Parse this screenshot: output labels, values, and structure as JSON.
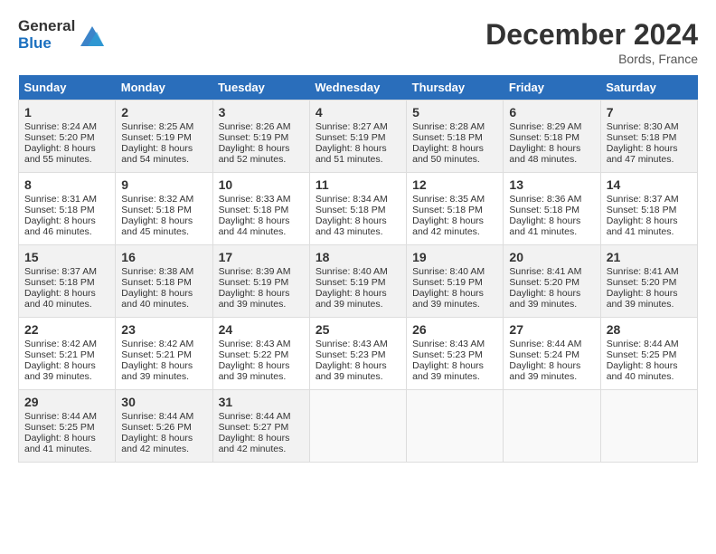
{
  "header": {
    "logo_line1": "General",
    "logo_line2": "Blue",
    "month_year": "December 2024",
    "location": "Bords, France"
  },
  "days_of_week": [
    "Sunday",
    "Monday",
    "Tuesday",
    "Wednesday",
    "Thursday",
    "Friday",
    "Saturday"
  ],
  "weeks": [
    [
      {
        "day": 1,
        "sunrise": "Sunrise: 8:24 AM",
        "sunset": "Sunset: 5:20 PM",
        "daylight": "Daylight: 8 hours and 55 minutes."
      },
      {
        "day": 2,
        "sunrise": "Sunrise: 8:25 AM",
        "sunset": "Sunset: 5:19 PM",
        "daylight": "Daylight: 8 hours and 54 minutes."
      },
      {
        "day": 3,
        "sunrise": "Sunrise: 8:26 AM",
        "sunset": "Sunset: 5:19 PM",
        "daylight": "Daylight: 8 hours and 52 minutes."
      },
      {
        "day": 4,
        "sunrise": "Sunrise: 8:27 AM",
        "sunset": "Sunset: 5:19 PM",
        "daylight": "Daylight: 8 hours and 51 minutes."
      },
      {
        "day": 5,
        "sunrise": "Sunrise: 8:28 AM",
        "sunset": "Sunset: 5:18 PM",
        "daylight": "Daylight: 8 hours and 50 minutes."
      },
      {
        "day": 6,
        "sunrise": "Sunrise: 8:29 AM",
        "sunset": "Sunset: 5:18 PM",
        "daylight": "Daylight: 8 hours and 48 minutes."
      },
      {
        "day": 7,
        "sunrise": "Sunrise: 8:30 AM",
        "sunset": "Sunset: 5:18 PM",
        "daylight": "Daylight: 8 hours and 47 minutes."
      }
    ],
    [
      {
        "day": 8,
        "sunrise": "Sunrise: 8:31 AM",
        "sunset": "Sunset: 5:18 PM",
        "daylight": "Daylight: 8 hours and 46 minutes."
      },
      {
        "day": 9,
        "sunrise": "Sunrise: 8:32 AM",
        "sunset": "Sunset: 5:18 PM",
        "daylight": "Daylight: 8 hours and 45 minutes."
      },
      {
        "day": 10,
        "sunrise": "Sunrise: 8:33 AM",
        "sunset": "Sunset: 5:18 PM",
        "daylight": "Daylight: 8 hours and 44 minutes."
      },
      {
        "day": 11,
        "sunrise": "Sunrise: 8:34 AM",
        "sunset": "Sunset: 5:18 PM",
        "daylight": "Daylight: 8 hours and 43 minutes."
      },
      {
        "day": 12,
        "sunrise": "Sunrise: 8:35 AM",
        "sunset": "Sunset: 5:18 PM",
        "daylight": "Daylight: 8 hours and 42 minutes."
      },
      {
        "day": 13,
        "sunrise": "Sunrise: 8:36 AM",
        "sunset": "Sunset: 5:18 PM",
        "daylight": "Daylight: 8 hours and 41 minutes."
      },
      {
        "day": 14,
        "sunrise": "Sunrise: 8:37 AM",
        "sunset": "Sunset: 5:18 PM",
        "daylight": "Daylight: 8 hours and 41 minutes."
      }
    ],
    [
      {
        "day": 15,
        "sunrise": "Sunrise: 8:37 AM",
        "sunset": "Sunset: 5:18 PM",
        "daylight": "Daylight: 8 hours and 40 minutes."
      },
      {
        "day": 16,
        "sunrise": "Sunrise: 8:38 AM",
        "sunset": "Sunset: 5:18 PM",
        "daylight": "Daylight: 8 hours and 40 minutes."
      },
      {
        "day": 17,
        "sunrise": "Sunrise: 8:39 AM",
        "sunset": "Sunset: 5:19 PM",
        "daylight": "Daylight: 8 hours and 39 minutes."
      },
      {
        "day": 18,
        "sunrise": "Sunrise: 8:40 AM",
        "sunset": "Sunset: 5:19 PM",
        "daylight": "Daylight: 8 hours and 39 minutes."
      },
      {
        "day": 19,
        "sunrise": "Sunrise: 8:40 AM",
        "sunset": "Sunset: 5:19 PM",
        "daylight": "Daylight: 8 hours and 39 minutes."
      },
      {
        "day": 20,
        "sunrise": "Sunrise: 8:41 AM",
        "sunset": "Sunset: 5:20 PM",
        "daylight": "Daylight: 8 hours and 39 minutes."
      },
      {
        "day": 21,
        "sunrise": "Sunrise: 8:41 AM",
        "sunset": "Sunset: 5:20 PM",
        "daylight": "Daylight: 8 hours and 39 minutes."
      }
    ],
    [
      {
        "day": 22,
        "sunrise": "Sunrise: 8:42 AM",
        "sunset": "Sunset: 5:21 PM",
        "daylight": "Daylight: 8 hours and 39 minutes."
      },
      {
        "day": 23,
        "sunrise": "Sunrise: 8:42 AM",
        "sunset": "Sunset: 5:21 PM",
        "daylight": "Daylight: 8 hours and 39 minutes."
      },
      {
        "day": 24,
        "sunrise": "Sunrise: 8:43 AM",
        "sunset": "Sunset: 5:22 PM",
        "daylight": "Daylight: 8 hours and 39 minutes."
      },
      {
        "day": 25,
        "sunrise": "Sunrise: 8:43 AM",
        "sunset": "Sunset: 5:23 PM",
        "daylight": "Daylight: 8 hours and 39 minutes."
      },
      {
        "day": 26,
        "sunrise": "Sunrise: 8:43 AM",
        "sunset": "Sunset: 5:23 PM",
        "daylight": "Daylight: 8 hours and 39 minutes."
      },
      {
        "day": 27,
        "sunrise": "Sunrise: 8:44 AM",
        "sunset": "Sunset: 5:24 PM",
        "daylight": "Daylight: 8 hours and 39 minutes."
      },
      {
        "day": 28,
        "sunrise": "Sunrise: 8:44 AM",
        "sunset": "Sunset: 5:25 PM",
        "daylight": "Daylight: 8 hours and 40 minutes."
      }
    ],
    [
      {
        "day": 29,
        "sunrise": "Sunrise: 8:44 AM",
        "sunset": "Sunset: 5:25 PM",
        "daylight": "Daylight: 8 hours and 41 minutes."
      },
      {
        "day": 30,
        "sunrise": "Sunrise: 8:44 AM",
        "sunset": "Sunset: 5:26 PM",
        "daylight": "Daylight: 8 hours and 42 minutes."
      },
      {
        "day": 31,
        "sunrise": "Sunrise: 8:44 AM",
        "sunset": "Sunset: 5:27 PM",
        "daylight": "Daylight: 8 hours and 42 minutes."
      },
      null,
      null,
      null,
      null
    ]
  ]
}
